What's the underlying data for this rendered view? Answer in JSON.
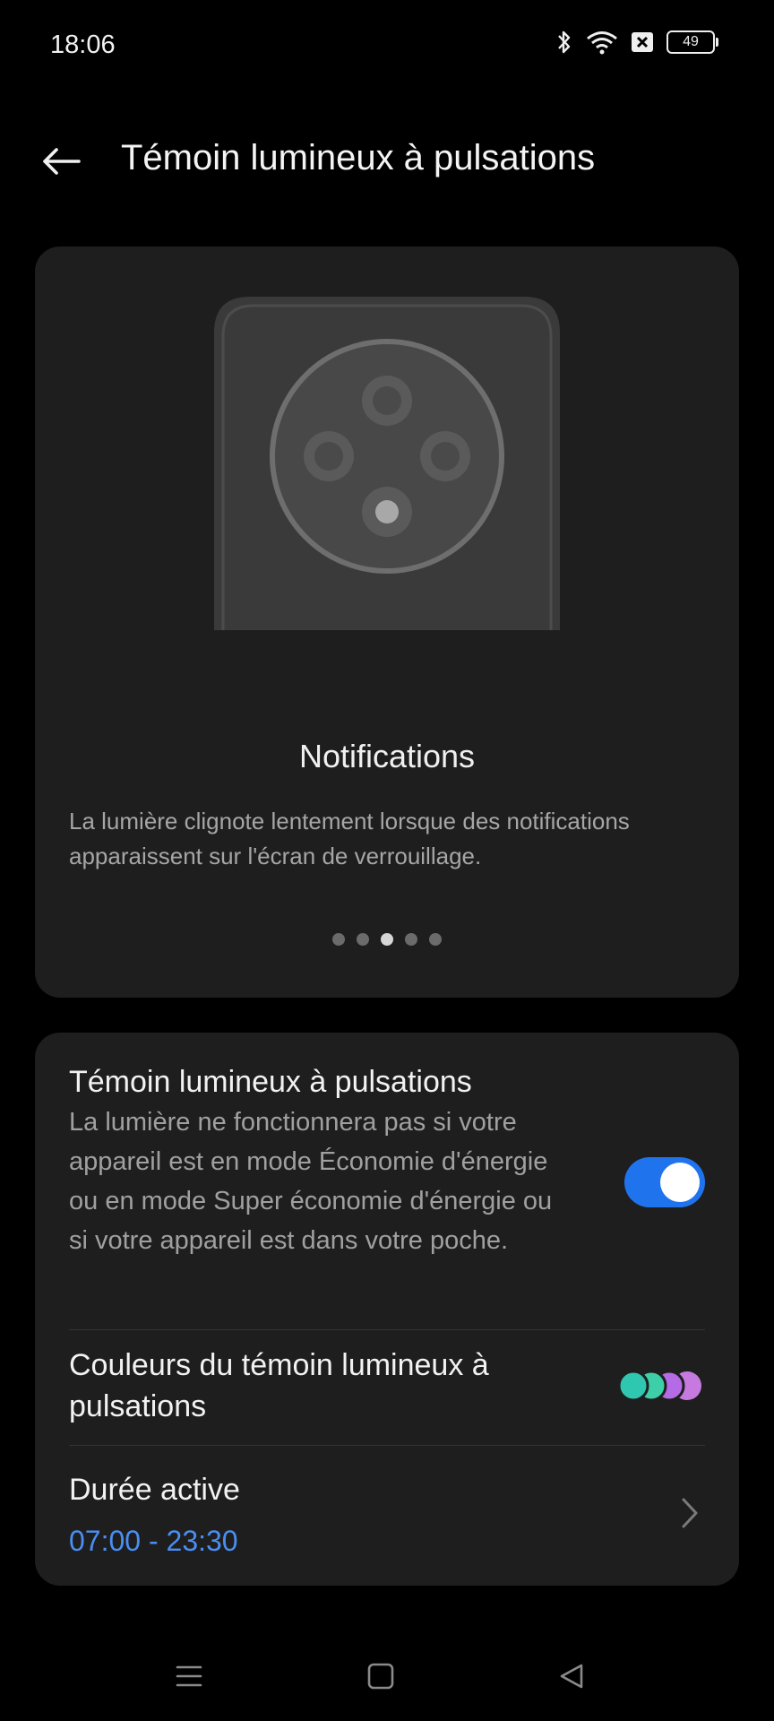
{
  "status_bar": {
    "time": "18:06",
    "battery": "49",
    "icons": [
      "bluetooth-icon",
      "wifi-icon",
      "no-sim-icon",
      "battery-icon"
    ]
  },
  "header": {
    "title": "Témoin lumineux à pulsations",
    "back_icon": "back-arrow-icon"
  },
  "preview": {
    "title": "Notifications",
    "description": "La lumière clignote lentement lorsque des notifications apparaissent sur l'écran de verrouillage.",
    "page_count": 5,
    "active_page": 3
  },
  "settings": {
    "pulse_light": {
      "title": "Témoin lumineux à pulsations",
      "description": "La lumière ne fonctionnera pas si votre appareil est en mode Économie d'énergie ou en mode Super économie d'énergie ou si votre appareil est dans votre poche.",
      "enabled": true
    },
    "colors": {
      "title": "Couleurs du témoin lumineux à pulsations",
      "swatches": [
        "#2fc7b0",
        "#3dd0a8",
        "#b56be6",
        "#c67ae0"
      ]
    },
    "active_duration": {
      "title": "Durée active",
      "value": "07:00  - 23:30"
    }
  },
  "navbar": {
    "icons": [
      "menu-icon",
      "home-icon",
      "back-icon"
    ]
  },
  "colors": {
    "accent": "#1f74ee",
    "link": "#4a8ef2",
    "card": "#1e1e1e",
    "background": "#000000"
  }
}
